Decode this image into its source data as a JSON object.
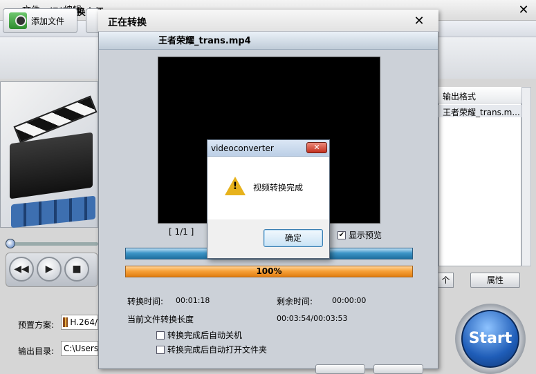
{
  "main_window": {
    "title": "3GP/MP4视频转换大师",
    "close_glyph": "✕",
    "menu": [
      "文件",
      "编辑"
    ],
    "toolbar": {
      "add_file_label": "添加文件"
    },
    "preset_label": "预置方案:",
    "preset_value": "H.264/",
    "output_dir_label": "输出目录:",
    "output_dir_value": "C:\\Users",
    "right_list": {
      "header": "输出格式",
      "row": "王者荣耀_trans.m..."
    },
    "count_button_label": "个",
    "properties_button_label": "属性",
    "start_label": "Start"
  },
  "convert_dialog": {
    "title": "正在转换",
    "close_glyph": "✕",
    "file_name": "王者荣耀_trans.mp4",
    "frame_counter": "[ 1/1 ]",
    "show_preview_label": "显示预览",
    "show_preview_checked": true,
    "progress_percent_text": "100%",
    "progress_percent": 100,
    "elapsed_label": "转换时间:",
    "elapsed_value": "00:01:18",
    "remaining_label": "剩余时间:",
    "remaining_value": "00:00:00",
    "length_label": "当前文件转换长度",
    "length_value": "00:03:54/00:03:53",
    "auto_shutdown_label": "转换完成后自动关机",
    "auto_open_folder_label": "转换完成后自动打开文件夹"
  },
  "message_box": {
    "title": "videoconverter",
    "close_glyph": "✕",
    "message": "视频转换完成",
    "ok_label": "确定"
  },
  "icons": [
    "warning-icon",
    "film-icon",
    "rewind-icon",
    "play-icon",
    "stop-icon",
    "close-icon",
    "add-file-icon"
  ]
}
